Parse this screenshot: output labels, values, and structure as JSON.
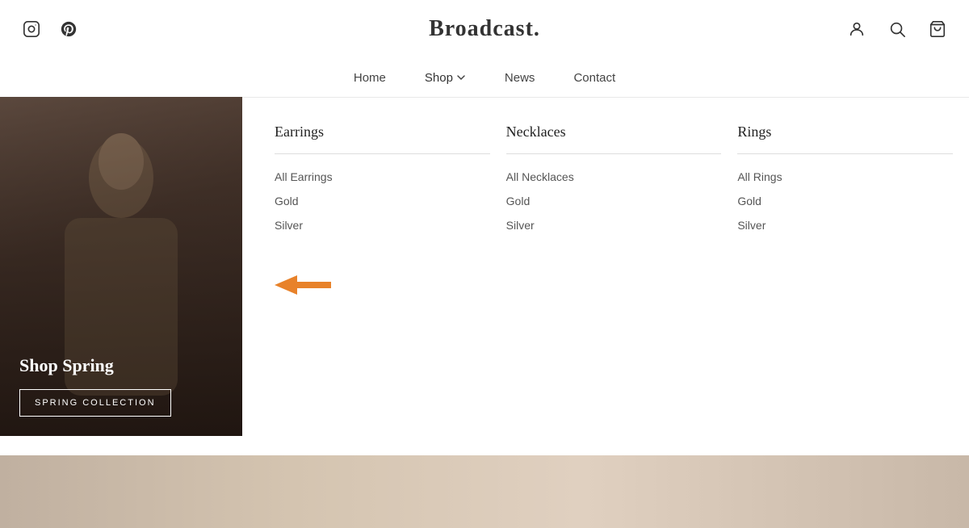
{
  "header": {
    "logo": "Broadcast.",
    "logo_dot": "."
  },
  "social": {
    "instagram_label": "Instagram",
    "pinterest_label": "Pinterest"
  },
  "nav": {
    "items": [
      {
        "label": "Home",
        "id": "home"
      },
      {
        "label": "Shop",
        "id": "shop",
        "hasDropdown": true
      },
      {
        "label": "News",
        "id": "news"
      },
      {
        "label": "Contact",
        "id": "contact"
      }
    ]
  },
  "dropdown": {
    "columns": [
      {
        "header": "Earrings",
        "items": [
          "All Earrings",
          "Gold",
          "Silver"
        ]
      },
      {
        "header": "Necklaces",
        "items": [
          "All Necklaces",
          "Gold",
          "Silver"
        ]
      },
      {
        "header": "Rings",
        "items": [
          "All Rings",
          "Gold",
          "Silver"
        ]
      }
    ],
    "arrow_label": "back arrow"
  },
  "hero": {
    "title": "Shop Spring",
    "button_label": "SPRING COLLECTION"
  },
  "icons": {
    "user": "user-icon",
    "search": "search-icon",
    "cart": "cart-icon"
  }
}
